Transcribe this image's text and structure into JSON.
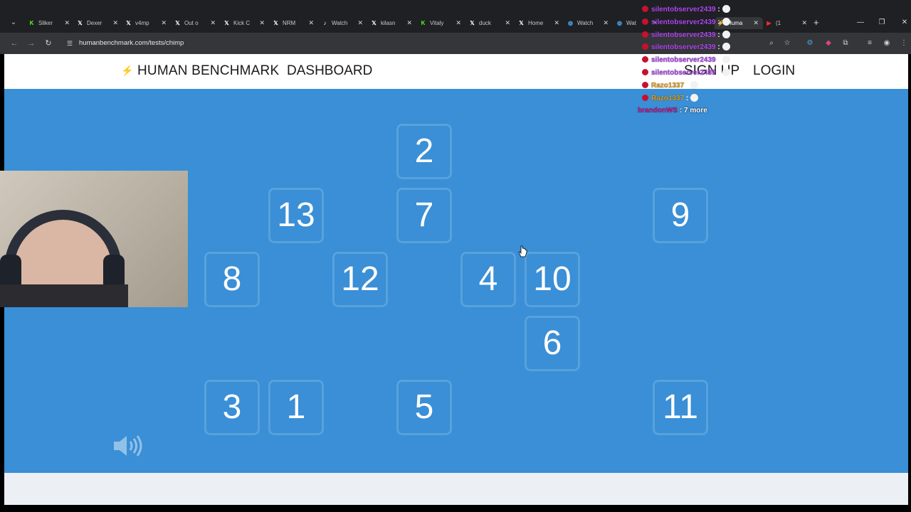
{
  "browser": {
    "tabs": [
      {
        "title": "Sliker",
        "icon": "kick-icon",
        "icon_glyph": "K",
        "icon_color": "#53fc18"
      },
      {
        "title": "Dexer",
        "icon": "x-icon",
        "icon_glyph": "𝕏",
        "icon_color": "#ffffff"
      },
      {
        "title": "v4mp",
        "icon": "x-icon",
        "icon_glyph": "𝕏",
        "icon_color": "#ffffff"
      },
      {
        "title": "Out o",
        "icon": "x-icon",
        "icon_glyph": "𝕏",
        "icon_color": "#ffffff"
      },
      {
        "title": "Kick C",
        "icon": "x-icon",
        "icon_glyph": "𝕏",
        "icon_color": "#ffffff"
      },
      {
        "title": "NRM",
        "icon": "x-icon",
        "icon_glyph": "𝕏",
        "icon_color": "#ffffff"
      },
      {
        "title": "Watch",
        "icon": "tiktok-icon",
        "icon_glyph": "♪",
        "icon_color": "#ffffff"
      },
      {
        "title": "kilasn",
        "icon": "x-icon",
        "icon_glyph": "𝕏",
        "icon_color": "#ffffff"
      },
      {
        "title": "Vitaly",
        "icon": "kick-icon",
        "icon_glyph": "K",
        "icon_color": "#53fc18"
      },
      {
        "title": "duck",
        "icon": "x-icon",
        "icon_glyph": "𝕏",
        "icon_color": "#ffffff"
      },
      {
        "title": "Home",
        "icon": "x-icon",
        "icon_glyph": "𝕏",
        "icon_color": "#ffffff"
      },
      {
        "title": "Watch",
        "icon": "globe-icon",
        "icon_glyph": "◍",
        "icon_color": "#4aa3e8"
      },
      {
        "title": "Wat",
        "icon": "globe-icon",
        "icon_glyph": "◍",
        "icon_color": "#4aa3e8"
      },
      {
        "title": "Huma",
        "icon": "humanbenchmark-icon",
        "icon_glyph": "⚡",
        "icon_color": "#f6c744",
        "active": true
      },
      {
        "title": "(1",
        "icon": "youtube-icon",
        "icon_glyph": "▶",
        "icon_color": "#ff2a2a"
      }
    ],
    "url": "humanbenchmark.com/tests/chimp"
  },
  "site": {
    "brand": "HUMAN BENCHMARK",
    "nav_dashboard": "DASHBOARD",
    "nav_signup": "SIGN UP",
    "nav_login": "LOGIN",
    "game_bg": "#3a8fd6"
  },
  "tiles": [
    {
      "n": "2"
    },
    {
      "n": "13"
    },
    {
      "n": "7"
    },
    {
      "n": "9"
    },
    {
      "n": "8"
    },
    {
      "n": "12"
    },
    {
      "n": "4"
    },
    {
      "n": "10"
    },
    {
      "n": "6"
    },
    {
      "n": "3"
    },
    {
      "n": "1"
    },
    {
      "n": "5"
    },
    {
      "n": "11"
    }
  ],
  "chat": {
    "messages": [
      {
        "user": "silentobserver2439",
        "color": "purple"
      },
      {
        "user": "silentobserver2439",
        "color": "purple"
      },
      {
        "user": "silentobserver2439",
        "color": "purple"
      },
      {
        "user": "silentobserver2439",
        "color": "purple"
      },
      {
        "user": "silentobserver2439",
        "color": "purple"
      },
      {
        "user": "silentobserver2439",
        "color": "purple"
      },
      {
        "user": "Razo1337",
        "color": "orange"
      },
      {
        "user": "Razo1337",
        "color": "orange"
      }
    ],
    "more_user": "brandonWS",
    "more_text": ": 7 more"
  }
}
